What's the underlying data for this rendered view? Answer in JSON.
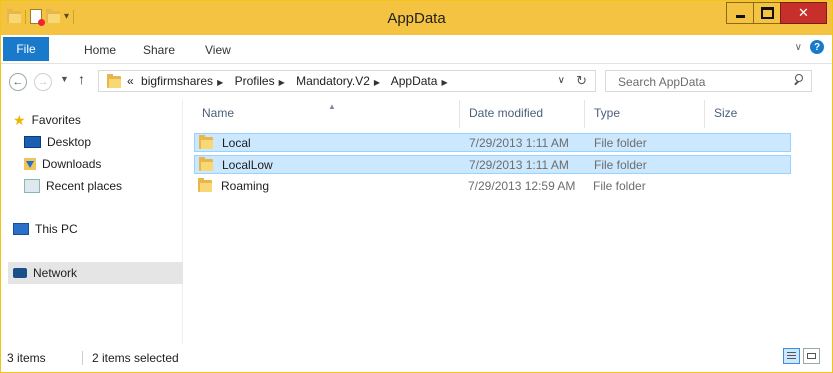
{
  "window": {
    "title": "AppData"
  },
  "ribbon": {
    "tabs": [
      "File",
      "Home",
      "Share",
      "View"
    ]
  },
  "address": {
    "prefix": "«",
    "crumbs": [
      "bigfirmshares",
      "Profiles",
      "Mandatory.V2",
      "AppData"
    ]
  },
  "search": {
    "placeholder": "Search AppData"
  },
  "nav": {
    "favorites_label": "Favorites",
    "favorites": [
      "Desktop",
      "Downloads",
      "Recent places"
    ],
    "this_pc": "This PC",
    "network": "Network"
  },
  "columns": [
    "Name",
    "Date modified",
    "Type",
    "Size"
  ],
  "files": [
    {
      "name": "Local",
      "date": "7/29/2013 1:11 AM",
      "type": "File folder",
      "size": "",
      "selected": true
    },
    {
      "name": "LocalLow",
      "date": "7/29/2013 1:11 AM",
      "type": "File folder",
      "size": "",
      "selected": true
    },
    {
      "name": "Roaming",
      "date": "7/29/2013 12:59 AM",
      "type": "File folder",
      "size": "",
      "selected": false
    }
  ],
  "status": {
    "item_count": "3 items",
    "selection": "2 items selected"
  },
  "icons": {
    "folder": "folder-icon",
    "back": "back-arrow-icon",
    "forward": "forward-arrow-icon",
    "up": "up-arrow-icon",
    "refresh": "refresh-icon",
    "search": "search-icon",
    "help": "help-icon"
  },
  "colors": {
    "title_bar": "#f5c342",
    "file_tab": "#1979ca",
    "close_button": "#c7302a",
    "selection_fill": "#cce8ff",
    "selection_border": "#99d1ff"
  }
}
